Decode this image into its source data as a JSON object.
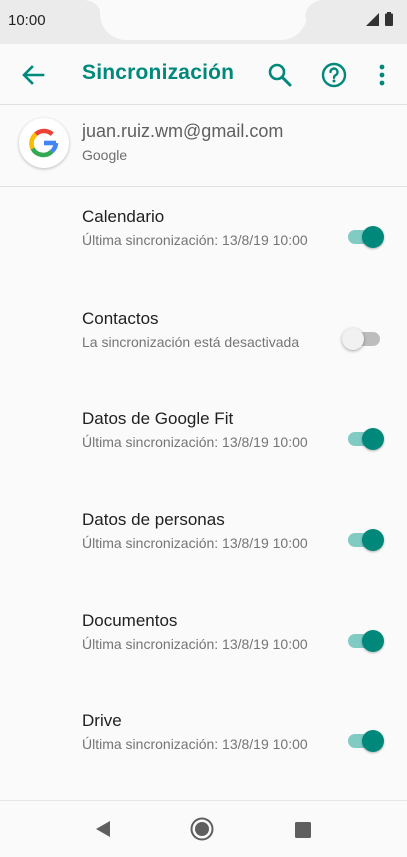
{
  "status_bar": {
    "time": "10:00"
  },
  "app_bar": {
    "title": "Sincronización",
    "accent_color": "#00897b"
  },
  "account": {
    "email": "juan.ruiz.wm@gmail.com",
    "provider": "Google"
  },
  "sync_items": [
    {
      "title": "Calendario",
      "subtitle": "Última sincronización: 13/8/19 10:00",
      "enabled": true
    },
    {
      "title": "Contactos",
      "subtitle": "La sincronización está desactivada",
      "enabled": false
    },
    {
      "title": "Datos de Google Fit",
      "subtitle": "Última sincronización: 13/8/19 10:00",
      "enabled": true
    },
    {
      "title": "Datos de personas",
      "subtitle": "Última sincronización: 13/8/19 10:00",
      "enabled": true
    },
    {
      "title": "Documentos",
      "subtitle": "Última sincronización: 13/8/19 10:00",
      "enabled": true
    },
    {
      "title": "Drive",
      "subtitle": "Última sincronización: 13/8/19 10:00",
      "enabled": true
    }
  ],
  "icons": {
    "back": "arrow-left-icon",
    "search": "search-icon",
    "help": "help-circle-icon",
    "menu": "more-vert-icon",
    "nav_back": "triangle-back-icon",
    "nav_home": "circle-home-icon",
    "nav_recent": "square-recent-icon"
  }
}
